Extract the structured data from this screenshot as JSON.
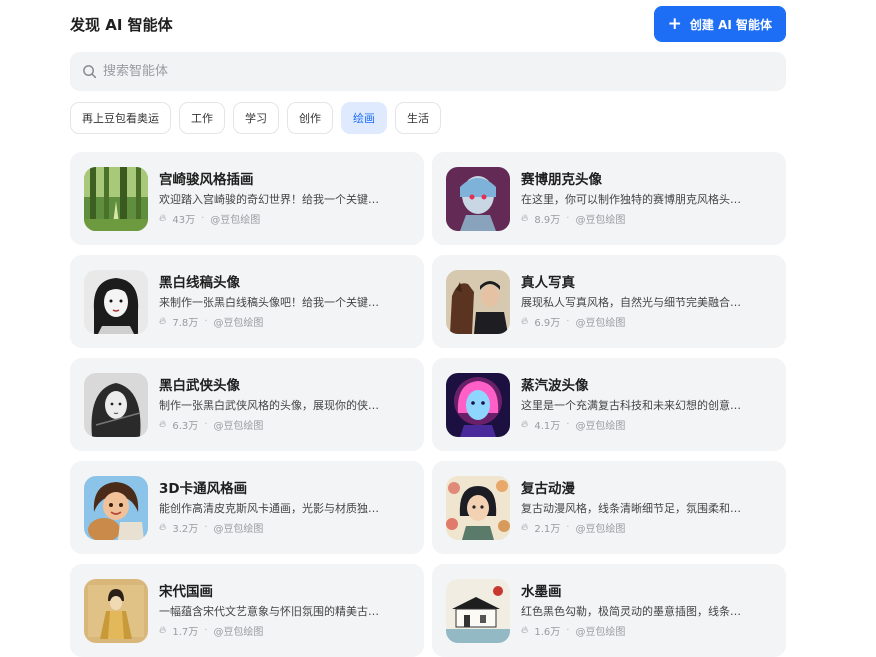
{
  "header": {
    "title": "发现 AI 智能体",
    "create_label": "创建 AI 智能体"
  },
  "search": {
    "placeholder": "搜索智能体"
  },
  "tabs": [
    {
      "label": "再上豆包看奥运",
      "active": false
    },
    {
      "label": "工作",
      "active": false
    },
    {
      "label": "学习",
      "active": false
    },
    {
      "label": "创作",
      "active": false
    },
    {
      "label": "绘画",
      "active": true
    },
    {
      "label": "生活",
      "active": false
    }
  ],
  "colors": {
    "accent": "#1d6ef5",
    "card_bg": "#f3f4f6",
    "active_tab_bg": "#dfeaff"
  },
  "cards": [
    {
      "title": "宫崎骏风格插画",
      "desc": "欢迎踏入宫崎骏的奇幻世界！给我一个关键…",
      "count": "43万",
      "author": "@豆包绘图",
      "thumb": "forest"
    },
    {
      "title": "赛博朋克头像",
      "desc": "在这里，你可以制作独特的赛博朋克风格头…",
      "count": "8.9万",
      "author": "@豆包绘图",
      "thumb": "cyber"
    },
    {
      "title": "黑白线稿头像",
      "desc": "来制作一张黑白线稿头像吧！给我一个关键…",
      "count": "7.8万",
      "author": "@豆包绘图",
      "thumb": "lineart"
    },
    {
      "title": "真人写真",
      "desc": "展现私人写真风格，自然光与细节完美融合…",
      "count": "6.9万",
      "author": "@豆包绘图",
      "thumb": "portrait"
    },
    {
      "title": "黑白武侠头像",
      "desc": "制作一张黑白武侠风格的头像，展现你的侠…",
      "count": "6.3万",
      "author": "@豆包绘图",
      "thumb": "wuxia"
    },
    {
      "title": "蒸汽波头像",
      "desc": "这里是一个充满复古科技和未来幻想的创意…",
      "count": "4.1万",
      "author": "@豆包绘图",
      "thumb": "vapor"
    },
    {
      "title": "3D卡通风格画",
      "desc": "能创作高清皮克斯风卡通画，光影与材质独…",
      "count": "3.2万",
      "author": "@豆包绘图",
      "thumb": "cartoon"
    },
    {
      "title": "复古动漫",
      "desc": "复古动漫风格，线条清晰细节足，氛围柔和…",
      "count": "2.1万",
      "author": "@豆包绘图",
      "thumb": "anime"
    },
    {
      "title": "宋代国画",
      "desc": "一幅蕴含宋代文艺意象与怀旧氛围的精美古…",
      "count": "1.7万",
      "author": "@豆包绘图",
      "thumb": "song"
    },
    {
      "title": "水墨画",
      "desc": "红色黑色勾勒，极简灵动的墨意插图，线条…",
      "count": "1.6万",
      "author": "@豆包绘图",
      "thumb": "ink"
    }
  ]
}
